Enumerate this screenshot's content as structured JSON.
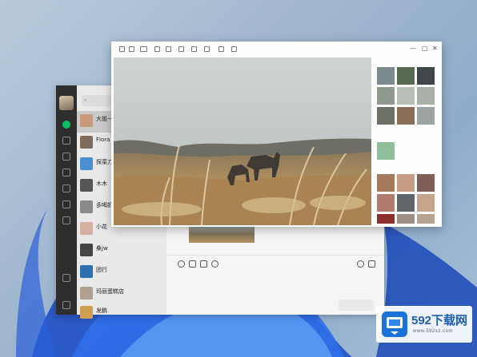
{
  "conversations": [
    {
      "name": "大姐一",
      "preview": "",
      "time": "",
      "color": "#c89a7a"
    },
    {
      "name": "Flora",
      "preview": "",
      "time": "",
      "color": "#7f6b5b"
    },
    {
      "name": "探菜刀",
      "preview": "",
      "time": "",
      "color": "#4a8fd1"
    },
    {
      "name": "木木",
      "preview": "",
      "time": "",
      "color": "#555555"
    },
    {
      "name": "多喝奶",
      "preview": "",
      "time": "",
      "color": "#8a8a8a"
    },
    {
      "name": "小花",
      "preview": "",
      "time": "",
      "color": "#d5b0a0"
    },
    {
      "name": "桑jw",
      "preview": "",
      "time": "",
      "color": "#444444"
    },
    {
      "name": "团行",
      "preview": "",
      "time": "",
      "color": "#2e6fb0"
    },
    {
      "name": "玛丽蛋糕店",
      "preview": "",
      "time": "",
      "color": "#b0a090"
    },
    {
      "name": "发鹏",
      "preview": "",
      "time": "",
      "color": "#d0a050"
    }
  ],
  "viewer": {
    "window_controls": [
      "—",
      "□",
      "✕"
    ]
  },
  "colors": {
    "accent": "#07c160",
    "sidebar": "#2e2e2e"
  },
  "watermark": {
    "title": "592下载网",
    "url": "www.592xz.com"
  }
}
